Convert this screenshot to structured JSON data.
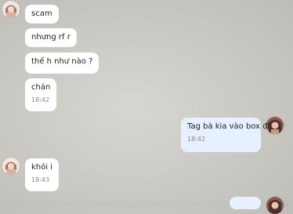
{
  "messages": [
    {
      "sender": "them",
      "text": "scam"
    },
    {
      "sender": "them",
      "text": "nhưng rf r"
    },
    {
      "sender": "them",
      "text": "thế h như nào ?"
    },
    {
      "sender": "them",
      "text": "chán",
      "time": "18:42"
    },
    {
      "sender": "me",
      "text": "Tag bà kia vào box đi",
      "time": "18:42"
    },
    {
      "sender": "them",
      "text": "khỏi i",
      "time": "18:43"
    },
    {
      "sender": "me",
      "text": ""
    }
  ]
}
